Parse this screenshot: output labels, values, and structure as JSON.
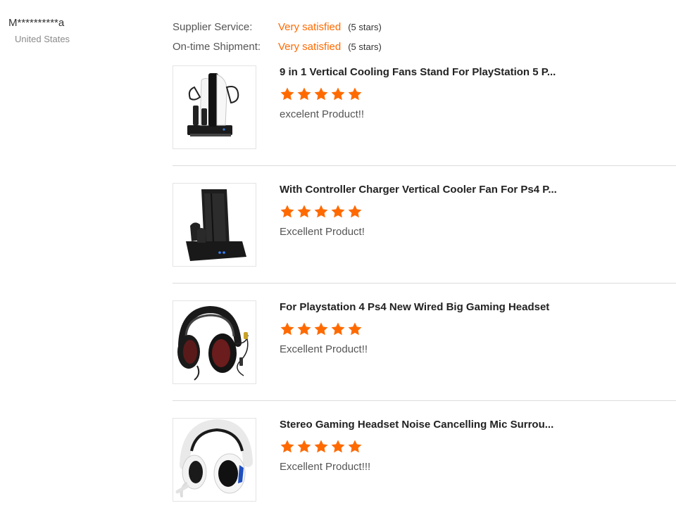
{
  "buyer": {
    "name": "M**********a",
    "country": "United States"
  },
  "ratings": [
    {
      "label": "Supplier Service:",
      "value": "Very satisfied",
      "stars": "(5 stars)"
    },
    {
      "label": "On-time Shipment:",
      "value": "Very satisfied",
      "stars": "(5 stars)"
    }
  ],
  "colors": {
    "accent": "#ff6a00",
    "divider": "#dcdcdc"
  },
  "reviews": [
    {
      "title": "9 in 1 Vertical Cooling Fans Stand For PlayStation 5 P...",
      "rating": 5,
      "comment": "excelent Product!!",
      "image_icon": "ps5-cooling-stand-image"
    },
    {
      "title": "With Controller Charger Vertical Cooler Fan For Ps4 P...",
      "rating": 5,
      "comment": "Excellent Product!",
      "image_icon": "ps4-cooling-stand-image"
    },
    {
      "title": "For Playstation 4 Ps4 New Wired Big Gaming Headset",
      "rating": 5,
      "comment": "Excellent Product!!",
      "image_icon": "black-red-headset-image"
    },
    {
      "title": "Stereo Gaming Headset Noise Cancelling Mic Surrou...",
      "rating": 5,
      "comment": "Excellent Product!!!",
      "image_icon": "white-blue-headset-image"
    }
  ]
}
